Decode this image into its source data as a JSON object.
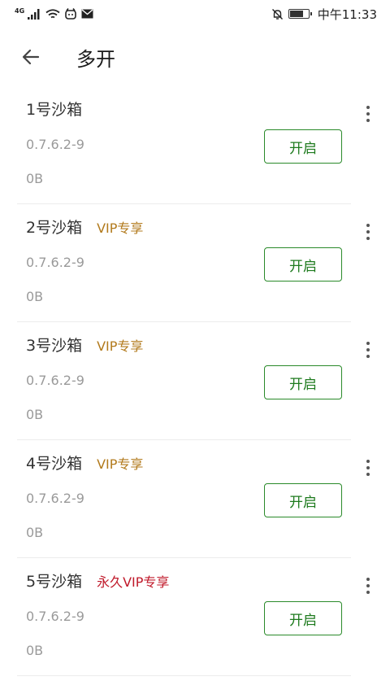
{
  "status_bar": {
    "network_type": "4G",
    "time": "中午11:33",
    "battery_level": 0.78,
    "icons": [
      "signal-icon",
      "wifi-icon",
      "app-notification-icon",
      "mail-icon",
      "mute-bell-icon",
      "battery-icon"
    ]
  },
  "toolbar": {
    "back_icon": "back-arrow-icon",
    "title": "多开"
  },
  "colors": {
    "open_button_accent": "#1d7a1d",
    "vip_badge": "#b27a1c",
    "permanent_vip_badge": "#c0192a"
  },
  "sandboxes": [
    {
      "name": "1号沙箱",
      "badge": "",
      "badge_type": "none",
      "version": "0.7.6.2-9",
      "size": "0B",
      "button": "开启"
    },
    {
      "name": "2号沙箱",
      "badge": "VIP专享",
      "badge_type": "vip",
      "version": "0.7.6.2-9",
      "size": "0B",
      "button": "开启"
    },
    {
      "name": "3号沙箱",
      "badge": "VIP专享",
      "badge_type": "vip",
      "version": "0.7.6.2-9",
      "size": "0B",
      "button": "开启"
    },
    {
      "name": "4号沙箱",
      "badge": "VIP专享",
      "badge_type": "vip",
      "version": "0.7.6.2-9",
      "size": "0B",
      "button": "开启"
    },
    {
      "name": "5号沙箱",
      "badge": "永久VIP专享",
      "badge_type": "permanent_vip",
      "version": "0.7.6.2-9",
      "size": "0B",
      "button": "开启"
    }
  ]
}
